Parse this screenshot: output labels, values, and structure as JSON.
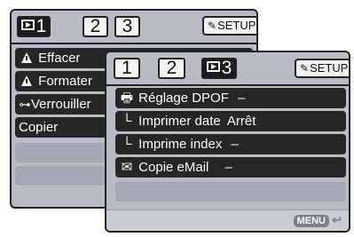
{
  "back_panel": {
    "tabs": [
      {
        "label": "1",
        "active": true,
        "icon": "playback-icon"
      },
      {
        "label": "2",
        "active": false
      },
      {
        "label": "3",
        "active": false
      }
    ],
    "setup_label": "SETUP",
    "items": [
      {
        "label": "Effacer",
        "icon": "warning-icon"
      },
      {
        "label": "Formater",
        "icon": "warning-icon"
      },
      {
        "label": "Verrouiller",
        "icon": "key-icon"
      },
      {
        "label": "Copier",
        "icon": ""
      }
    ]
  },
  "front_panel": {
    "tabs": [
      {
        "label": "1",
        "active": false
      },
      {
        "label": "2",
        "active": false
      },
      {
        "label": "3",
        "active": true,
        "icon": "playback-icon"
      }
    ],
    "setup_label": "SETUP",
    "items": [
      {
        "label": "Réglage DPOF",
        "value": "–",
        "icon": "printer-icon",
        "glyph": "🖶"
      },
      {
        "label": "Imprimer date",
        "value": "Arrêt",
        "icon": "sub-item-icon",
        "glyph": "└"
      },
      {
        "label": "Imprime index",
        "value": "–",
        "icon": "sub-item-icon",
        "glyph": "└"
      },
      {
        "label": "Copie eMail",
        "value": "–",
        "icon": "envelope-icon",
        "glyph": "✉"
      }
    ],
    "menu_button": "MENU"
  },
  "colors": {
    "panel_bg": "#b9bcc5",
    "row_bg": "#262626",
    "active_tab": "#1c1c1c"
  }
}
